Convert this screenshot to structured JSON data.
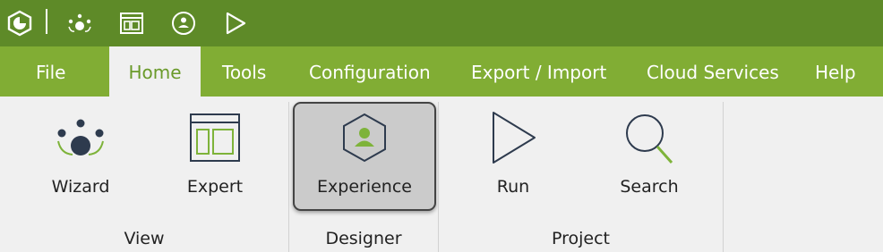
{
  "menu": {
    "tabs": [
      {
        "label": "File"
      },
      {
        "label": "Home",
        "active": true
      },
      {
        "label": "Tools"
      },
      {
        "label": "Configuration"
      },
      {
        "label": "Export / Import"
      },
      {
        "label": "Cloud Services"
      },
      {
        "label": "Help"
      }
    ]
  },
  "quick_access": {
    "icons": [
      "app-logo-icon",
      "wizard-view-icon",
      "expert-view-icon",
      "experience-designer-icon",
      "run-icon"
    ]
  },
  "ribbon": {
    "groups": [
      {
        "label": "View",
        "buttons": [
          {
            "label": "Wizard",
            "icon": "wizard-icon"
          },
          {
            "label": "Expert",
            "icon": "expert-icon"
          }
        ]
      },
      {
        "label": "Designer",
        "buttons": [
          {
            "label": "Experience",
            "icon": "experience-icon",
            "selected": true
          }
        ]
      },
      {
        "label": "Project",
        "buttons": [
          {
            "label": "Run",
            "icon": "run-icon"
          },
          {
            "label": "Search",
            "icon": "search-icon"
          }
        ]
      }
    ]
  },
  "colors": {
    "title_bar": "#5e8a28",
    "menu_bar": "#81ad34",
    "accent": "#7eb33a",
    "icon_dark": "#2e3b4e"
  }
}
